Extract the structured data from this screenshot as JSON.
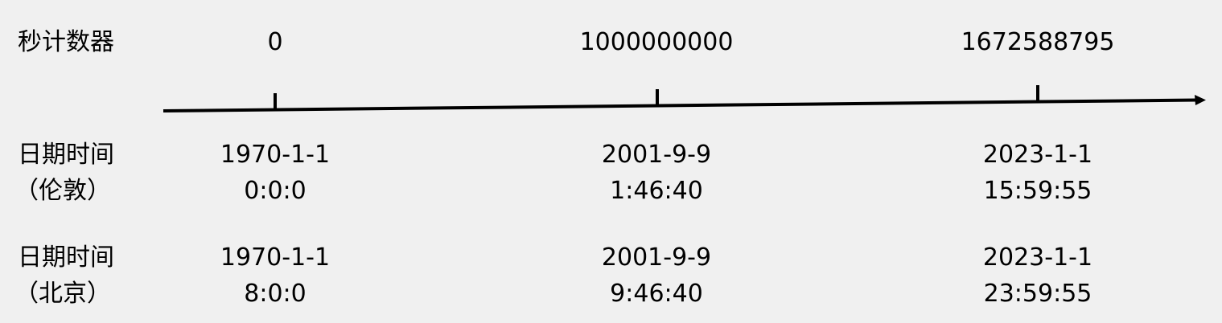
{
  "rows": {
    "counter_label": "秒计数器",
    "london_label_line1": "日期时间",
    "london_label_line2": "（伦敦）",
    "beijing_label_line1": "日期时间",
    "beijing_label_line2": "（北京）"
  },
  "points": [
    {
      "seconds": "0",
      "london_date": "1970-1-1",
      "london_time": "0:0:0",
      "beijing_date": "1970-1-1",
      "beijing_time": "8:0:0"
    },
    {
      "seconds": "1000000000",
      "london_date": "2001-9-9",
      "london_time": "1:46:40",
      "beijing_date": "2001-9-9",
      "beijing_time": "9:46:40"
    },
    {
      "seconds": "1672588795",
      "london_date": "2023-1-1",
      "london_time": "15:59:55",
      "beijing_date": "2023-1-1",
      "beijing_time": "23:59:55"
    }
  ]
}
